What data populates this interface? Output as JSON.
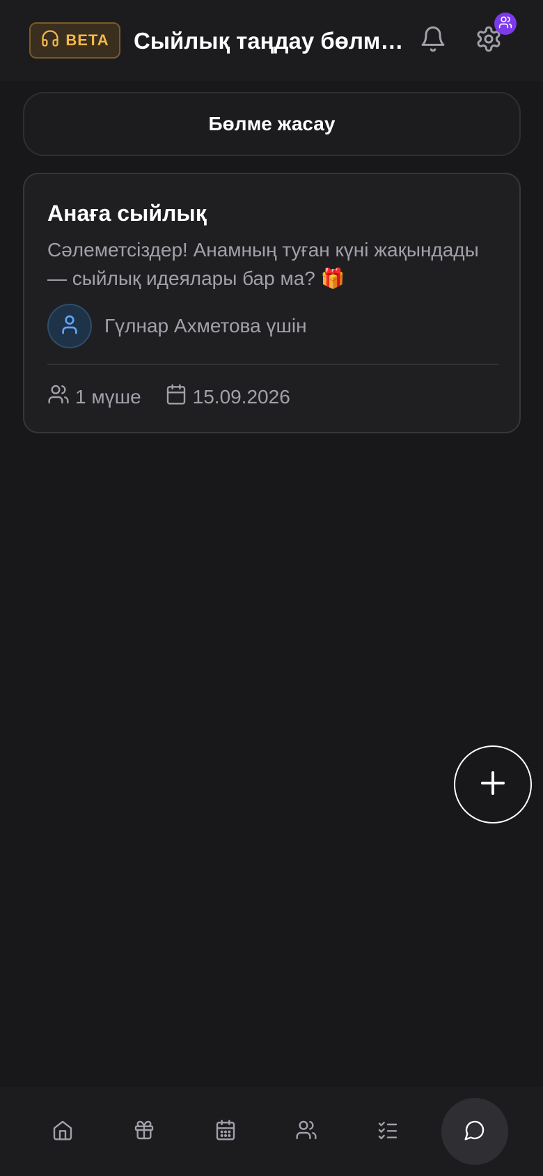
{
  "header": {
    "beta_label": "BETA",
    "room_title": "Сыйлық таңдау бөлме..."
  },
  "actions": {
    "create_room_label": "Бөлме жасау"
  },
  "rooms": [
    {
      "title": "Анаға сыйлық",
      "description": "Сәлеметсіздер! Анамның туған күні жақындады — сыйлық идеялары бар ма? 🎁",
      "for_label": "Гүлнар Ахметова үшін",
      "members": "1 мүше",
      "date": "15.09.2026"
    }
  ],
  "nav": {
    "items": [
      {
        "icon": "home-icon"
      },
      {
        "icon": "gift-icon"
      },
      {
        "icon": "calendar-icon"
      },
      {
        "icon": "people-icon"
      },
      {
        "icon": "tasks-icon"
      },
      {
        "icon": "chat-icon",
        "active": true
      }
    ]
  },
  "colors": {
    "background": "#18181b",
    "surface": "#1f1f22",
    "beta_accent": "#f2b84b",
    "badge_purple": "#7c3aed",
    "avatar_blue": "#60a5fa",
    "text_muted": "#a1a1aa"
  }
}
